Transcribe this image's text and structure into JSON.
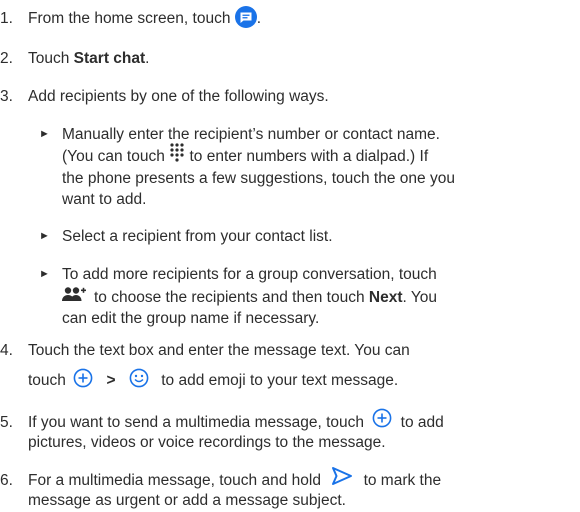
{
  "colors": {
    "accent": "#1a73e8",
    "text": "#2d2d2d"
  },
  "steps": [
    {
      "num": "1.",
      "a": "From the home screen, touch",
      "icon": "messages-app-icon",
      "b": "."
    },
    {
      "num": "2.",
      "a": "Touch ",
      "bold": "Start chat",
      "b": "."
    },
    {
      "num": "3.",
      "a": "Add recipients by one of the following ways."
    },
    {
      "num": "4.",
      "a": "Touch the text box and enter the message text. You can",
      "line2a": "touch",
      "icon1": "add-icon",
      "sep": ">",
      "icon2": "emoji-icon",
      "line2b": "to add emoji to your text message."
    },
    {
      "num": "5.",
      "a": "If you want to send a multimedia message, touch",
      "icon": "add-icon",
      "b": "to add",
      "line2": "pictures, videos or voice recordings to the message."
    },
    {
      "num": "6.",
      "a": "For a multimedia message, touch and hold",
      "icon": "send-icon",
      "b": "to mark the",
      "line2": "message as urgent or add a message subject."
    }
  ],
  "bullets": [
    {
      "mark": "►",
      "lines": [
        "Manually enter the recipient’s number or contact name."
      ],
      "after": {
        "a": "(You can touch",
        "icon": "dialpad-icon",
        "b": "to enter numbers with a dialpad.) If",
        "rest": [
          "the phone presents a few suggestions, touch the one you",
          "want to add."
        ]
      }
    },
    {
      "mark": "►",
      "lines": [
        "Select a recipient from your contact list."
      ]
    },
    {
      "mark": "►",
      "lines": [
        "To add more recipients for a group conversation, touch"
      ],
      "after": {
        "icon": "group-add-icon",
        "a": "to choose the recipients and then touch ",
        "bold": "Next",
        "b": ". You",
        "rest": [
          "can edit the group name if necessary."
        ]
      }
    }
  ]
}
